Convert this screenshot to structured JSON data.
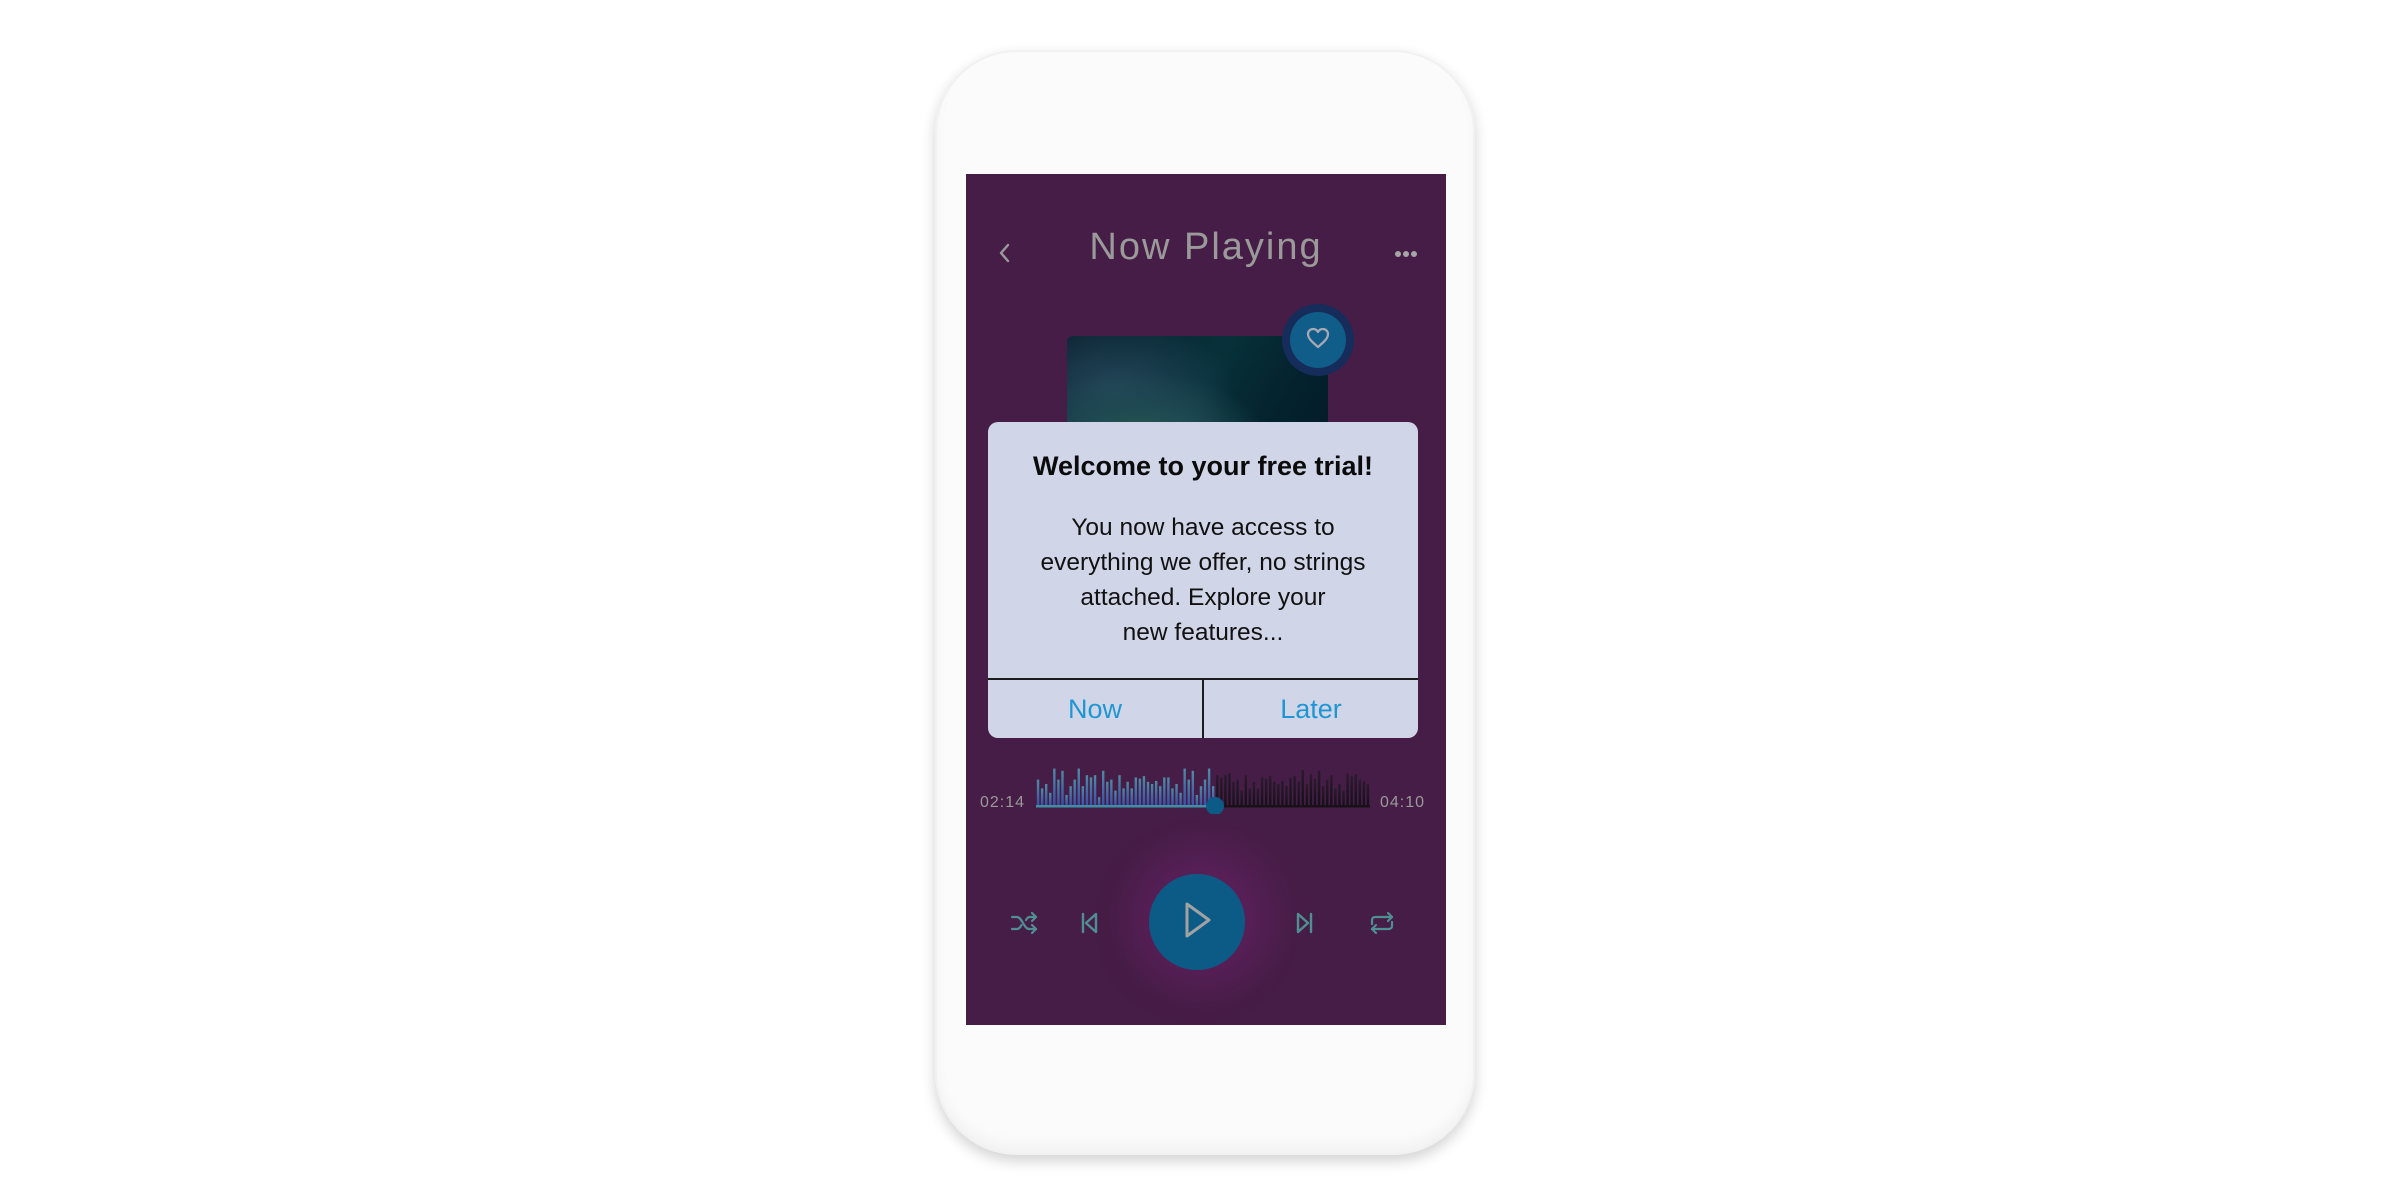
{
  "header": {
    "title": "Now Playing",
    "back_icon": "chevron-left-icon",
    "more_icon": "more-horizontal-icon"
  },
  "album": {
    "favorite_icon": "heart-icon"
  },
  "dialog": {
    "title": "Welcome to your free trial!",
    "body": "You now have access to everything we offer, no strings attached. Explore your new features...",
    "body_lines": [
      "You now have access to",
      "everything we offer, no strings",
      "attached. Explore your",
      "new features..."
    ],
    "buttons": [
      {
        "label": "Now"
      },
      {
        "label": "Later"
      }
    ]
  },
  "playback": {
    "elapsed": "02:14",
    "duration": "04:10",
    "progress_fraction": 0.536,
    "waveform_levels": [
      0.6,
      0.4,
      0.5,
      0.3,
      0.85,
      0.6,
      0.8,
      0.25,
      0.45,
      0.6,
      0.85,
      0.45,
      0.7,
      0.65,
      0.7,
      0.2,
      0.8,
      0.55,
      0.6,
      0.35,
      0.7,
      0.4,
      0.55,
      0.4,
      0.65,
      0.62,
      0.68,
      0.55,
      0.5,
      0.57,
      0.45,
      0.65,
      0.65,
      0.4,
      0.5,
      0.3,
      0.85,
      0.6,
      0.8,
      0.25,
      0.45,
      0.6,
      0.85,
      0.45,
      0.7,
      0.65,
      0.7,
      0.75,
      0.55,
      0.6,
      0.35,
      0.7,
      0.4,
      0.55,
      0.4,
      0.65,
      0.62,
      0.68,
      0.55,
      0.5,
      0.57,
      0.45,
      0.65,
      0.68,
      0.56,
      0.82,
      0.5,
      0.72,
      0.62,
      0.8,
      0.45,
      0.6,
      0.7,
      0.4,
      0.5,
      0.35,
      0.74,
      0.68,
      0.72,
      0.6,
      0.56,
      0.5
    ],
    "controls": {
      "shuffle_icon": "shuffle-icon",
      "previous_icon": "skip-previous-icon",
      "play_icon": "play-icon",
      "next_icon": "skip-next-icon",
      "repeat_icon": "repeat-icon"
    }
  },
  "colors": {
    "screen_bg": "#461d46",
    "accent": "#0c5b87",
    "dialog_bg": "#d0d6e8",
    "dialog_button": "#1f96d4",
    "text_muted": "#9a9a9a",
    "control_icon": "#4f8f92"
  }
}
